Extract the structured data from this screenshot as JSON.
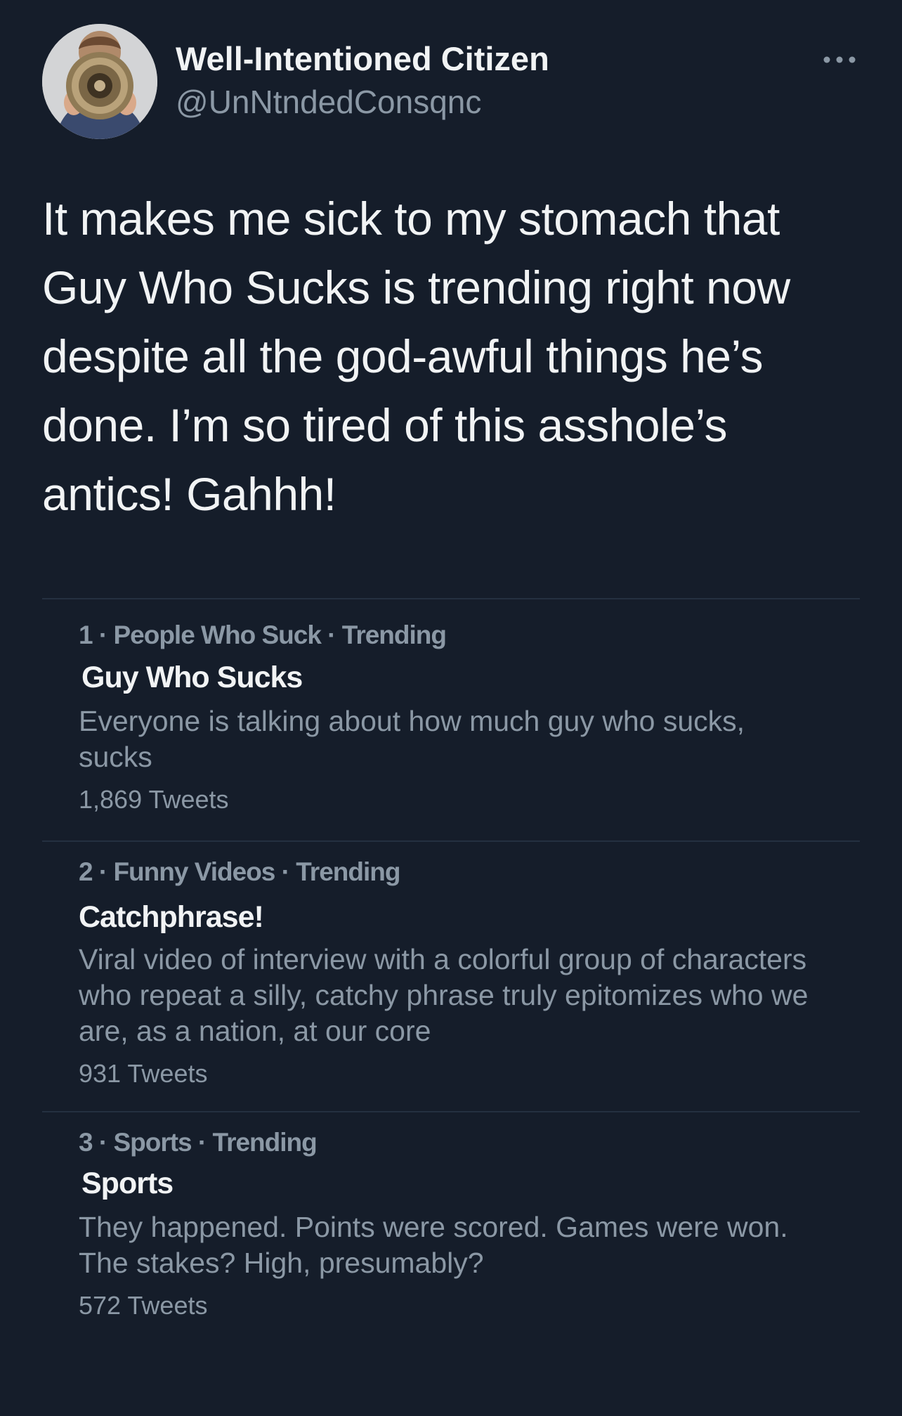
{
  "tweet": {
    "author": {
      "display_name": "Well-Intentioned Citizen",
      "handle": "@UnNtndedConsqnc",
      "avatar_icon": "megaphone-avatar"
    },
    "more_icon": "more-horizontal-icon",
    "text": "It makes me sick to my stomach that Guy Who Sucks is trending right now despite all the god-awful things he’s done. I’m so tired of this asshole’s antics! Gahhh!"
  },
  "trends": [
    {
      "meta": "1 · People Who Suck · Trending",
      "title": "Guy Who Sucks",
      "description": "Everyone is talking about how much guy who sucks, sucks",
      "count": "1,869 Tweets"
    },
    {
      "meta": "2 · Funny Videos · Trending",
      "title": "Catchphrase!",
      "description": "Viral video of interview with a colorful group of characters who repeat a silly, catchy phrase truly epitomizes who we are, as a nation, at our core",
      "count": "931 Tweets"
    },
    {
      "meta": "3 · Sports · Trending",
      "title": "Sports",
      "description": "They happened. Points were scored. Games were won. The stakes? High, presumably?",
      "count": "572 Tweets"
    }
  ],
  "colors": {
    "background": "#151d2a",
    "primary_text": "#f1f3f4",
    "secondary_text": "#8b98a5",
    "divider": "#243040"
  }
}
